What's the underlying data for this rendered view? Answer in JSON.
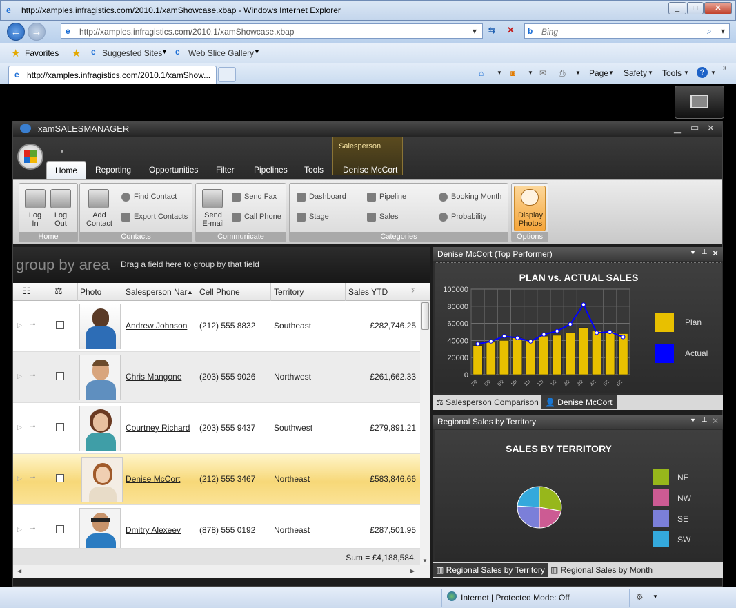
{
  "browser": {
    "window_title": "http://xamples.infragistics.com/2010.1/xamShowcase.xbap - Windows Internet Explorer",
    "url": "http://xamples.infragistics.com/2010.1/xamShowcase.xbap",
    "search_placeholder": "Bing",
    "favorites_label": "Favorites",
    "suggested_sites": "Suggested Sites",
    "web_slice_gallery": "Web Slice Gallery",
    "tab_title": "http://xamples.infragistics.com/2010.1/xamShow...",
    "commands": {
      "page": "Page",
      "safety": "Safety",
      "tools": "Tools"
    },
    "status_zone": "Internet | Protected Mode: Off"
  },
  "app": {
    "title": "xamSALESMANAGER",
    "context_group": "Salesperson",
    "ribbon_tabs": [
      "Home",
      "Reporting",
      "Opportunities",
      "Filter",
      "Pipelines",
      "Tools",
      "Denise McCort"
    ],
    "groups": {
      "home": {
        "label": "Home",
        "login": "Log\nIn",
        "logout": "Log\nOut"
      },
      "contacts": {
        "label": "Contacts",
        "add_contact": "Add\nContact",
        "find_contact": "Find Contact",
        "export_contacts": "Export Contacts"
      },
      "communicate": {
        "label": "Communicate",
        "send_email": "Send\nE-mail",
        "send_fax": "Send Fax",
        "call_phone": "Call Phone"
      },
      "categories": {
        "label": "Categories",
        "dashboard": "Dashboard",
        "stage": "Stage",
        "pipeline": "Pipeline",
        "sales": "Sales",
        "booking_month": "Booking Month",
        "probability": "Probability"
      },
      "options": {
        "label": "Options",
        "display_photos": "Display\nPhotos"
      }
    }
  },
  "grid": {
    "group_by_label": "group by area",
    "group_hint": "Drag a field here to group by that field",
    "columns": [
      "Photo",
      "Salesperson Nar",
      "Cell Phone",
      "Territory",
      "Sales YTD"
    ],
    "rows": [
      {
        "name": "Andrew Johnson",
        "phone": "(212) 555 8832",
        "territory": "Southeast",
        "sales": "£282,746.25"
      },
      {
        "name": "Chris Mangone",
        "phone": "(203) 555 9026",
        "territory": "Northwest",
        "sales": "£261,662.33"
      },
      {
        "name": "Courtney Richard",
        "phone": "(203) 555 9437",
        "territory": "Southwest",
        "sales": "£279,891.21"
      },
      {
        "name": "Denise McCort",
        "phone": "(212) 555 3467",
        "territory": "Northeast",
        "sales": "£583,846.66"
      },
      {
        "name": "Dmitry Alexeev",
        "phone": "(878) 555 0192",
        "territory": "Northeast",
        "sales": "£287,501.95"
      }
    ],
    "sum": "Sum = £4,188,584."
  },
  "top_panel": {
    "title": "Denise McCort (Top Performer)",
    "tab_comparison": "Salesperson Comparison",
    "tab_person": "Denise McCort"
  },
  "bottom_panel": {
    "title": "Regional Sales by Territory",
    "tab_territory": "Regional Sales by Territory",
    "tab_month": "Regional Sales by Month"
  },
  "chart_data": [
    {
      "type": "bar",
      "title": "PLAN vs. ACTUAL SALES",
      "ylim": [
        0,
        100000
      ],
      "yticks": [
        "0",
        "20000",
        "40000",
        "60000",
        "80000",
        "100000"
      ],
      "xticks": [
        "7/2",
        "8/2",
        "9/2",
        "10/",
        "11/",
        "12/",
        "1/2",
        "2/2",
        "3/2",
        "4/2",
        "5/2",
        "6/2"
      ],
      "series": [
        {
          "name": "Plan",
          "type": "bar",
          "values": [
            34000,
            38000,
            40000,
            43000,
            41000,
            45000,
            46000,
            49000,
            55000,
            51000,
            50000,
            48000
          ]
        },
        {
          "name": "Actual",
          "type": "line",
          "values": [
            36000,
            39000,
            45000,
            43000,
            39000,
            47000,
            51000,
            59000,
            82000,
            49000,
            50000,
            44000
          ]
        }
      ],
      "colors": {
        "Plan": "#e8c000",
        "Actual": "#0000ff"
      }
    },
    {
      "type": "pie",
      "title": "SALES BY TERRITORY",
      "categories": [
        "NE",
        "NW",
        "SE",
        "SW"
      ],
      "values": [
        28,
        22,
        26,
        24
      ],
      "colors": [
        "#97b71b",
        "#cc5b93",
        "#7b7fd9",
        "#34a9dc"
      ]
    }
  ]
}
